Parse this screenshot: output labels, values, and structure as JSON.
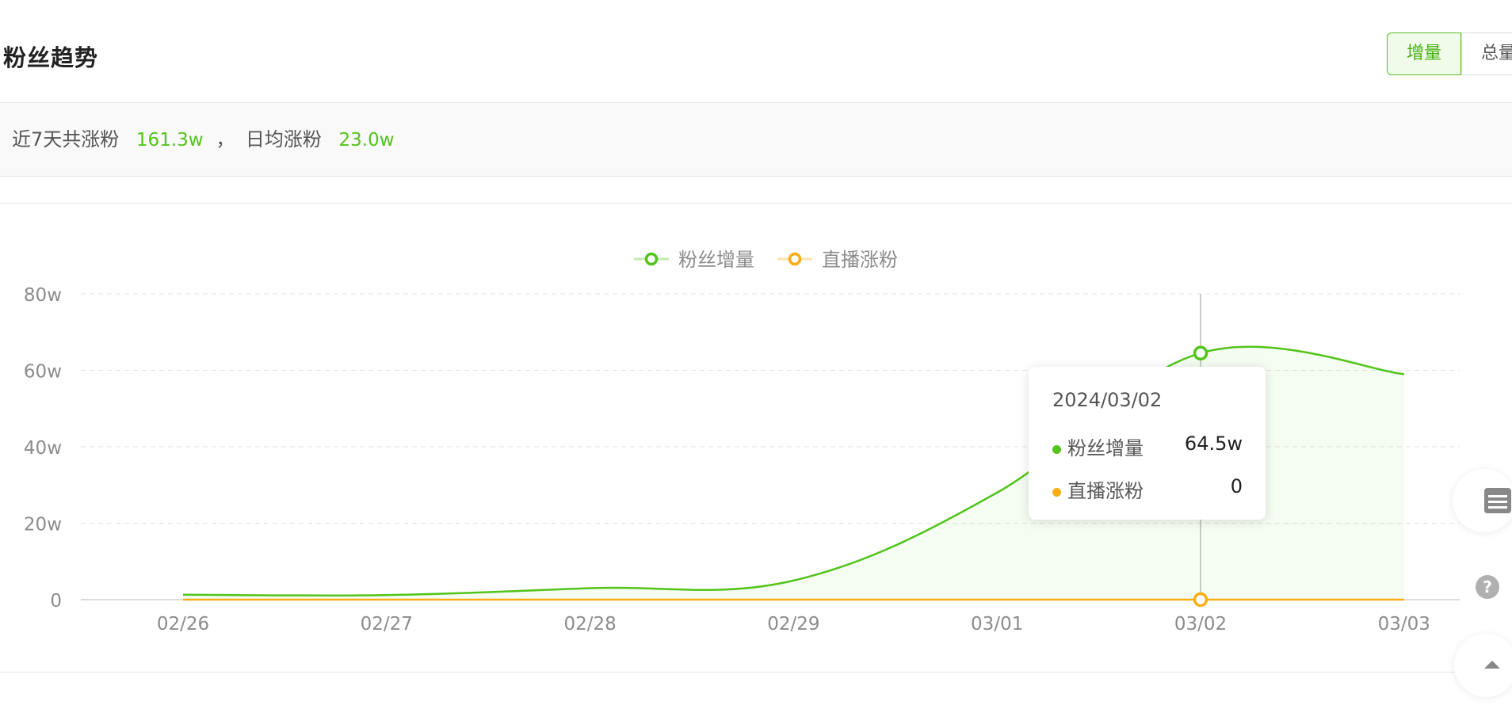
{
  "header": {
    "title": "粉丝趋势",
    "toggle_increase": "增量",
    "toggle_total": "总量"
  },
  "summary": {
    "prefix": "近7天共涨粉",
    "total": "161.3w",
    "separator": "，",
    "daily_label": "日均涨粉",
    "daily": "23.0w"
  },
  "colors": {
    "primary": "#52c41a",
    "secondary": "#faad14"
  },
  "chart_data": {
    "type": "line",
    "categories": [
      "02/26",
      "02/27",
      "02/28",
      "02/29",
      "03/01",
      "03/02",
      "03/03"
    ],
    "series": [
      {
        "name": "粉丝增量",
        "values": [
          1.3,
          1.2,
          3.0,
          5.0,
          28.0,
          64.5,
          59.0
        ],
        "color": "#52c41a",
        "area": true
      },
      {
        "name": "直播涨粉",
        "values": [
          0,
          0,
          0,
          0,
          0,
          0,
          0
        ],
        "color": "#faad14",
        "area": false
      }
    ],
    "ylim": [
      0,
      80
    ],
    "yticks": [
      0,
      20,
      40,
      60,
      80
    ],
    "ytick_labels": [
      "0",
      "20w",
      "40w",
      "60w",
      "80w"
    ],
    "grid": true,
    "legend": "top-center",
    "tooltip": {
      "index": 5,
      "date": "2024/03/02",
      "rows": [
        {
          "name": "粉丝增量",
          "value": "64.5w",
          "color": "#52c41a"
        },
        {
          "name": "直播涨粉",
          "value": "0",
          "color": "#faad14"
        }
      ]
    }
  }
}
